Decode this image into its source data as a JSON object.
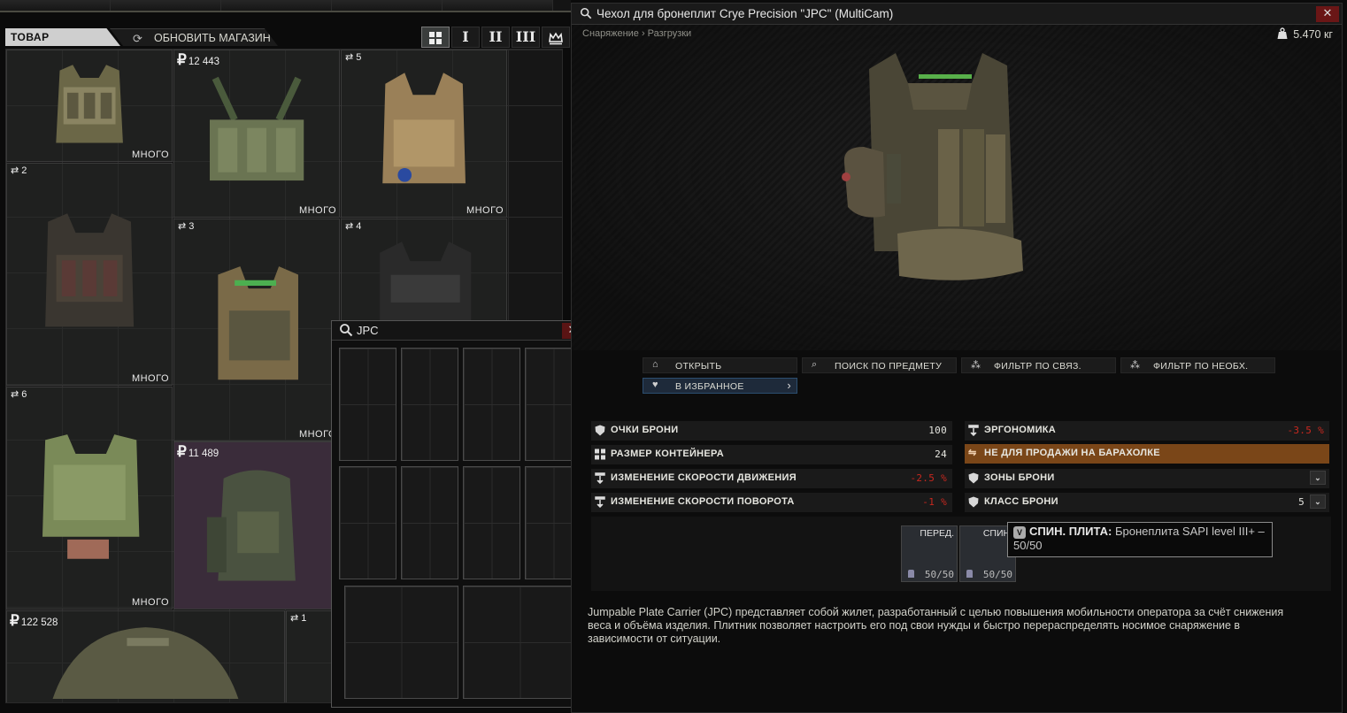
{
  "shop": {
    "tab_goods": "ТОВАР",
    "tab_refresh": "ОБНОВИТЬ МАГАЗИН",
    "view_buttons": [
      "I",
      "II",
      "III"
    ],
    "items": [
      {
        "price": "",
        "badge": "",
        "many": "МНОГО"
      },
      {
        "price": "12 443",
        "badge": "",
        "many": "МНОГО"
      },
      {
        "price": "",
        "badge": "5",
        "many": "МНОГО"
      },
      {
        "price": "",
        "badge": "2",
        "many": "МНОГО"
      },
      {
        "price": "",
        "badge": "3",
        "many": "МНОГО"
      },
      {
        "price": "",
        "badge": "4",
        "many": ""
      },
      {
        "price": "",
        "badge": "6",
        "many": "МНОГО"
      },
      {
        "price": "11 489",
        "badge": "",
        "many": ""
      },
      {
        "price": "122 528",
        "badge": "",
        "many": ""
      },
      {
        "price": "",
        "badge": "1",
        "many": ""
      }
    ]
  },
  "search_popup": {
    "query": "JPC"
  },
  "inspect": {
    "title": "Чехол для бронеплит Crye Precision \"JPC\" (MultiCam)",
    "breadcrumb": "Снаряжение › Разгрузки",
    "weight": "5.470 кг",
    "actions": {
      "open": "ОТКРЫТЬ",
      "search": "ПОИСК ПО ПРЕДМЕТУ",
      "filter_linked": "ФИЛЬТР ПО СВЯЗ.",
      "filter_required": "ФИЛЬТР ПО НЕОБХ.",
      "favorite": "В ИЗБРАННОЕ"
    },
    "stats": {
      "armor_points": {
        "label": "ОЧКИ БРОНИ",
        "value": "100"
      },
      "container_size": {
        "label": "РАЗМЕР КОНТЕЙНЕРА",
        "value": "24"
      },
      "move_speed": {
        "label": "ИЗМЕНЕНИЕ СКОРОСТИ ДВИЖЕНИЯ",
        "value": "-2.5 %"
      },
      "turn_speed": {
        "label": "ИЗМЕНЕНИЕ СКОРОСТИ ПОВОРОТА",
        "value": "-1 %"
      },
      "ergonomics": {
        "label": "ЭРГОНОМИКА",
        "value": "-3.5 %"
      },
      "not_for_sale": {
        "label": "НЕ ДЛЯ ПРОДАЖИ НА БАРАХОЛКЕ"
      },
      "armor_zones": {
        "label": "ЗОНЫ БРОНИ"
      },
      "armor_class": {
        "label": "КЛАСС БРОНИ",
        "value": "5"
      }
    },
    "plates": [
      {
        "label": "ПЕРЕД.",
        "durability": "50/50"
      },
      {
        "label": "СПИН.",
        "durability": "50/50"
      }
    ],
    "tooltip": {
      "icon": "V",
      "title": "СПИН. ПЛИТА:",
      "text": "Бронеплита SAPI level III+ – 50/50"
    },
    "description": "Jumpable Plate Carrier (JPC) представляет собой жилет, разработанный с целью повышения мобильности оператора за счёт снижения веса и объёма изделия. Плитник позволяет настроить его под свои нужды и быстро перераспределять носимое снаряжение в зависимости от ситуации.",
    "colors": {
      "negative": "#c8281f",
      "not_for_sale_bg": "#7a4618",
      "favorite_bg": "#1e2a3a"
    }
  }
}
